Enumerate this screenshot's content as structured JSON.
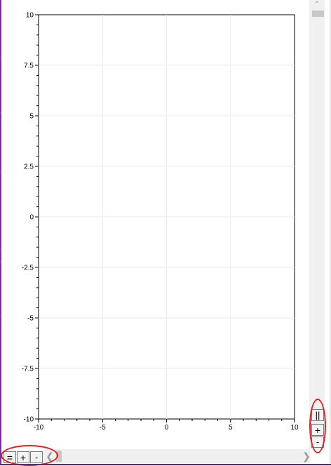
{
  "chart_data": {
    "type": "line",
    "title": "",
    "xlabel": "",
    "ylabel": "",
    "xlim": [
      -10,
      10
    ],
    "ylim": [
      -10,
      10
    ],
    "x_ticks": [
      "-10",
      "-5",
      "0",
      "5",
      "10"
    ],
    "y_ticks": [
      "10",
      "7.5",
      "5",
      "2.5",
      "0",
      "-2.5",
      "-5",
      "-7.5",
      "-10"
    ],
    "grid": true,
    "series": []
  },
  "vertical_zoom": {
    "fit_label": "||",
    "zoom_in_label": "+",
    "zoom_out_label": "-"
  },
  "horizontal_zoom": {
    "fit_label": "=",
    "zoom_in_label": "+",
    "zoom_out_label": "-"
  },
  "scrollbars": {
    "up_arrow": "^",
    "left_arrow": "<",
    "right_arrow": ">"
  },
  "colors": {
    "highlight_ring": "#e01f1f",
    "window_border": "#7b2f8e",
    "grid": "#ebebeb",
    "axis": "#000000"
  }
}
